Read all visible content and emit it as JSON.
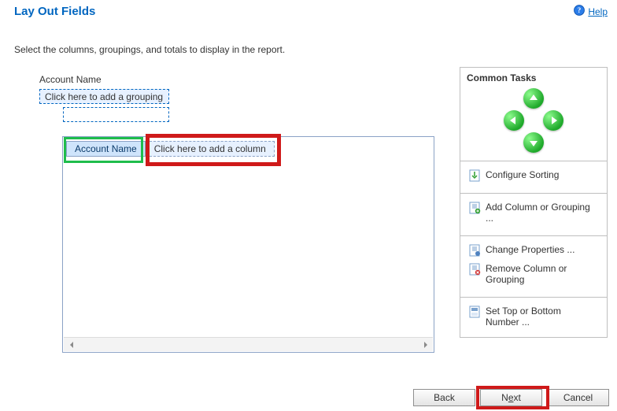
{
  "header": {
    "title": "Lay Out Fields",
    "help_label": "Help"
  },
  "instruction": "Select the columns, groupings, and totals to display in the report.",
  "layout": {
    "root_label": "Account Name",
    "grouping_placeholder": "Click here to add a grouping",
    "columns": {
      "selected": "Account Name",
      "add_placeholder": "Click here to add a column"
    }
  },
  "sidebar": {
    "title": "Common Tasks",
    "tasks": {
      "configure_sorting": "Configure Sorting",
      "add_column_grouping": "Add Column or Grouping ...",
      "change_properties": "Change Properties ...",
      "remove_column_grouping": "Remove Column or Grouping",
      "set_top_bottom": "Set Top or Bottom Number ..."
    }
  },
  "footer": {
    "back": "Back",
    "next_pre": "N",
    "next_u": "e",
    "next_post": "xt",
    "cancel": "Cancel"
  }
}
